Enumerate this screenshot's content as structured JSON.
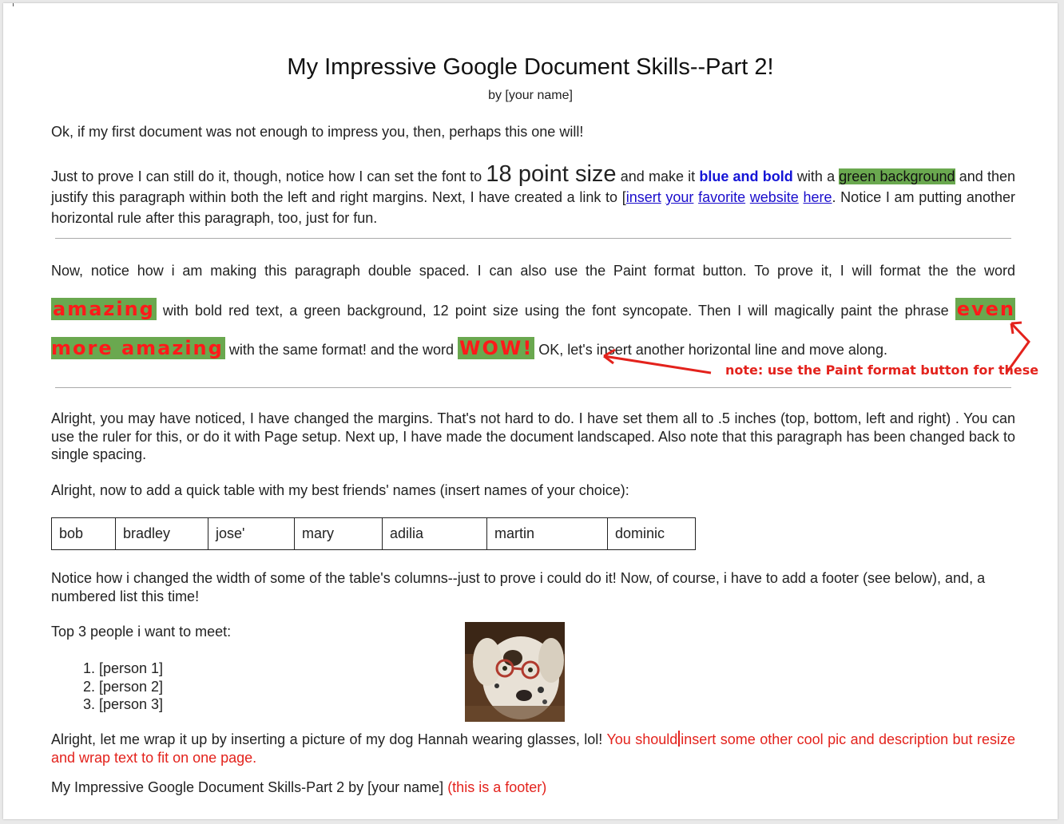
{
  "doc": {
    "title": "My Impressive Google Document Skills--Part 2!",
    "byline": "by [your name]",
    "intro": "Ok, if my first document was not enough to impress you, then, perhaps this one will!",
    "p2": {
      "a": "Just to prove I can still do it, though,  notice how I can set the font to ",
      "big": "18 point size",
      "b": " and make it ",
      "bluebold": "blue and bold",
      "c": " with a ",
      "green": "green background",
      "d": " and then justify this paragraph within both the left and right margins.  Next, I have created a link to [",
      "links": [
        "insert",
        "your",
        "favorite",
        "website",
        "here"
      ],
      "e": ".  Notice I am putting another horizontal rule after this paragraph, too, just for fun."
    },
    "p3": {
      "a": "Now, notice how i am making this paragraph double spaced.   I can also use the Paint format button.  To prove it, I will format the the word ",
      "amazing": "amazing",
      "b": " with bold red text, a green background, 12 point size using the font syncopate.  Then I will magically paint the phrase ",
      "even_more": "even more amazing",
      "c": " with the same format!  and the word ",
      "wow": "WOW!",
      "d": "  OK, let's insert another horizontal line and move along."
    },
    "note": "note: use the Paint format button for these",
    "p4": "Alright, you may have noticed, I have changed the margins.   That's not hard to do.   I have set them all to .5 inches (top, bottom, left and right) .  You can use the ruler for this, or do it with Page setup.  Next up, I have made the document landscaped.   Also note that this paragraph has been changed back to single spacing.",
    "p5": "Alright, now to add a quick table with my best friends' names (insert names of your choice):",
    "friends": [
      "bob",
      "bradley",
      "jose'",
      "mary",
      "adilia",
      "martin",
      "dominic"
    ],
    "p6": "Notice how i changed the width of some of the table's columns--just to prove i could do it!  Now, of course, i have to add a footer (see below), and, a numbered list this time!",
    "list_heading": "Top 3 people i want to meet:",
    "people": [
      "[person 1]",
      "[person 2]",
      "[person 3]"
    ],
    "p7": {
      "a": "Alright, let me wrap it up by inserting a picture of my dog Hannah wearing glasses, lol!  ",
      "red1": "You should",
      "red2": "insert some other cool pic and description but resize and wrap text to fit on one page."
    },
    "footer": {
      "text": "My Impressive Google Document Skills-Part 2 by  [your name]  ",
      "note": "(this is a footer)"
    }
  },
  "colors": {
    "green_highlight": "#6aa84f",
    "red_text": "#e3221c",
    "blue_bold": "#1414d6",
    "link": "#1a0dcc"
  }
}
